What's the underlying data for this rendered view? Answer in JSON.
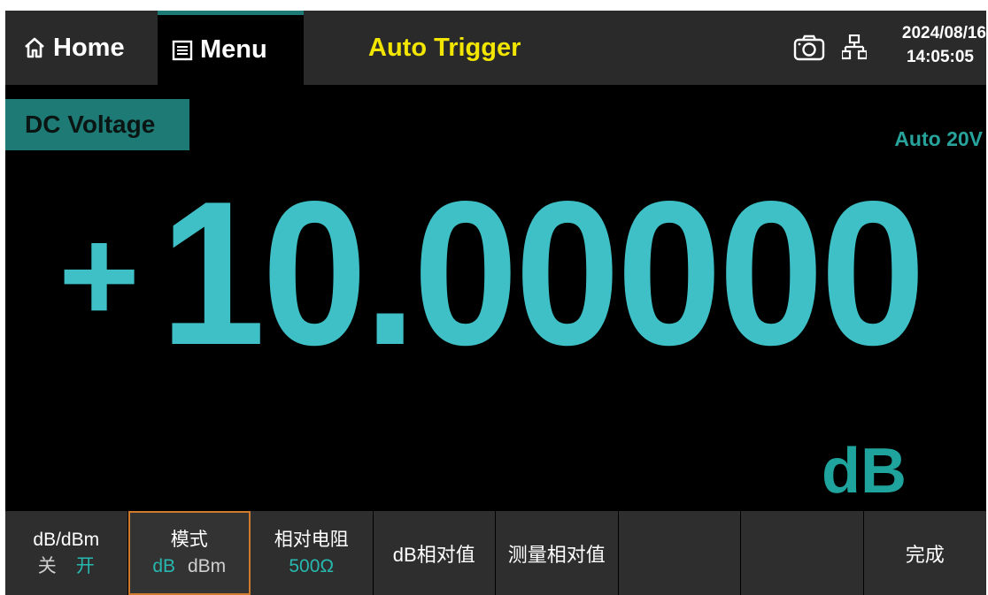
{
  "topbar": {
    "home_label": "Home",
    "menu_label": "Menu",
    "trigger_label": "Auto Trigger",
    "date": "2024/08/16",
    "time": "14:05:05"
  },
  "measurement": {
    "function": "DC Voltage",
    "range": "Auto 20V",
    "sign": "+",
    "value": "10.00000",
    "unit": "dB"
  },
  "softkeys": [
    {
      "top": "dB/dBm",
      "options": [
        "关",
        "开"
      ],
      "selected": "开"
    },
    {
      "top": "模式",
      "options": [
        "dB",
        "dBm"
      ],
      "selected": "dB"
    },
    {
      "top": "相对电阻",
      "value": "500Ω"
    },
    {
      "label": "dB相对值"
    },
    {
      "label": "测量相对值"
    },
    {
      "label": ""
    },
    {
      "label": ""
    },
    {
      "label": "完成"
    }
  ],
  "colors": {
    "accent_teal": "#1e7a74",
    "reading_cyan": "#3fc0c6",
    "trigger_yellow": "#f2e600",
    "active_softkey_border": "#d07a2e"
  },
  "icons": [
    "home-icon",
    "menu-icon",
    "camera-icon",
    "lan-icon"
  ]
}
